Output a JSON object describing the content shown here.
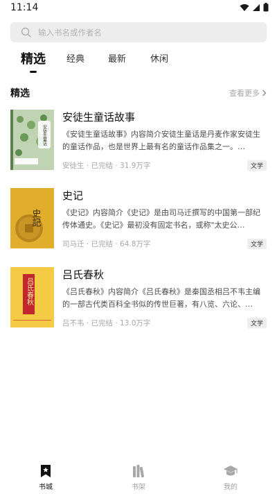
{
  "status": {
    "time": "11:14"
  },
  "search": {
    "placeholder": "输入书名或作者名"
  },
  "tabs": [
    {
      "label": "精选",
      "active": true
    },
    {
      "label": "经典",
      "active": false
    },
    {
      "label": "最新",
      "active": false
    },
    {
      "label": "休闲",
      "active": false
    }
  ],
  "section": {
    "title": "精选",
    "more": "查看更多"
  },
  "books": [
    {
      "title": "安徒生童话故事",
      "desc": "《安徒生童话故事》内容简介安徒生童话是丹麦作家安徒生的童话作品，也是世界上最有名的童话作品集之一。…",
      "meta": "安徒生 · 已完结 · 31.9万字",
      "tag": "文学",
      "cover_text": "安徒生童话"
    },
    {
      "title": "史记",
      "desc": "《史记》内容简介《史记》是由司马迁撰写的中国第一部纪传体通史。《史记》最初没有固定书名，或称\"太史公…",
      "meta": "司马迁 · 已完结 · 64.8万字",
      "tag": "文学",
      "cover_text": "史記"
    },
    {
      "title": "吕氏春秋",
      "desc": "《吕氏春秋》内容简介《吕氏春秋》是秦国丞相吕不韦主编的一部古代类百科全书似的传世巨著，有八览、六论、…",
      "meta": "吕不韦 · 已完结 · 13.0万字",
      "tag": "文学",
      "cover_text": "吕氏春秋"
    }
  ],
  "nav": [
    {
      "label": "书城",
      "icon": "bookmark-star-icon",
      "active": true
    },
    {
      "label": "书架",
      "icon": "bookshelf-icon",
      "active": false
    },
    {
      "label": "我的",
      "icon": "graduation-cap-icon",
      "active": false
    }
  ],
  "colors": {
    "accent": "#111111",
    "muted": "#a6a6a6",
    "search_bg": "#ededed"
  }
}
